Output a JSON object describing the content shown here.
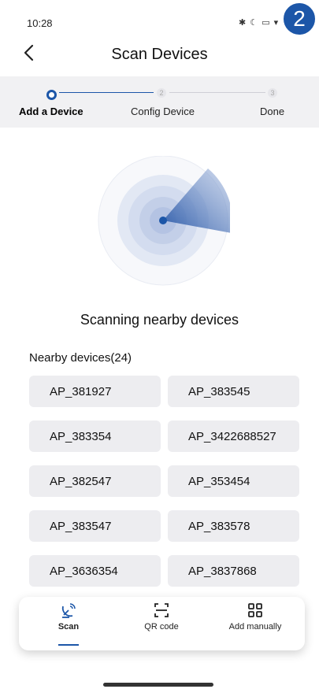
{
  "status_bar": {
    "time": "10:28",
    "icons": "✱ ☾ ▭ ▾",
    "badge": "2"
  },
  "header": {
    "title": "Scan Devices"
  },
  "stepper": {
    "steps": [
      {
        "number": "1",
        "label": "Add a Device"
      },
      {
        "number": "2",
        "label": "Config Device"
      },
      {
        "number": "3",
        "label": "Done"
      }
    ],
    "accent": "#1c56a8"
  },
  "scan": {
    "status_text": "Scanning nearby devices"
  },
  "nearby": {
    "title": "Nearby devices(24)",
    "devices": [
      "AP_381927",
      "AP_383545",
      "AP_383354",
      "AP_3422688527",
      "AP_382547",
      "AP_353454",
      "AP_383547",
      "AP_383578",
      "AP_3636354",
      "AP_3837868"
    ]
  },
  "bottom_nav": {
    "items": [
      {
        "label": "Scan",
        "icon": "satellite-dish-icon"
      },
      {
        "label": "QR code",
        "icon": "qr-scan-icon"
      },
      {
        "label": "Add manually",
        "icon": "grid-icon"
      }
    ]
  }
}
